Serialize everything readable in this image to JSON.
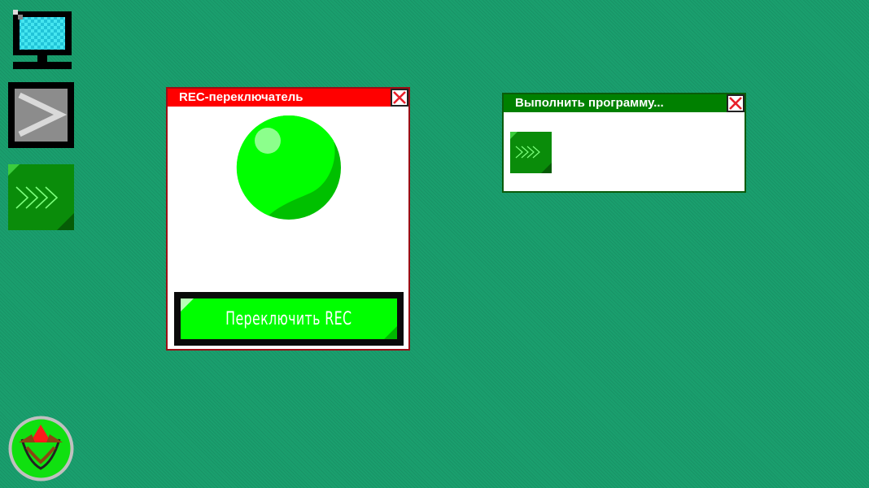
{
  "desktop": {
    "icons": [
      {
        "name": "computer-icon"
      },
      {
        "name": "terminal-icon"
      },
      {
        "name": "run-program-icon"
      },
      {
        "name": "app-logo-icon"
      }
    ]
  },
  "rec_window": {
    "title": "REC-переключатель",
    "indicator_color": "#00ff00",
    "toggle_label": "Переключить REC"
  },
  "run_window": {
    "title": "Выполнить программу..."
  },
  "colors": {
    "desktop_bg": "#1a9f6e",
    "rec_titlebar": "#ff0000",
    "run_titlebar": "#008000",
    "accent_green": "#00ff00"
  }
}
